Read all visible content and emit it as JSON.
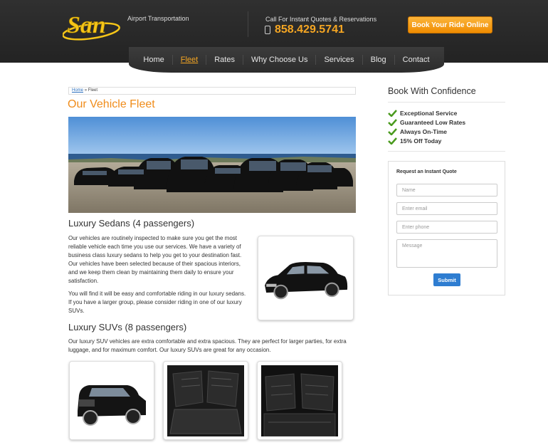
{
  "header": {
    "logo_text": "San",
    "logo_subtitle": "Airport Transportation",
    "call_text": "Call For Instant Quotes & Reservations",
    "phone": "858.429.5741",
    "book_button": "Book Your Ride Online"
  },
  "nav": {
    "items": [
      "Home",
      "Fleet",
      "Rates",
      "Why Choose Us",
      "Services",
      "Blog",
      "Contact"
    ],
    "active": "Fleet"
  },
  "breadcrumb": {
    "home": "Home",
    "separator": "»",
    "current": "Fleet"
  },
  "main": {
    "title": "Our Vehicle Fleet",
    "sedans_heading": "Luxury Sedans (4 passengers)",
    "sedans_p1": "Our vehicles are routinely inspected to make sure you get the most reliable vehicle each time you use our services. We have a variety of business class luxury sedans to help you get to your destination fast. Our vehicles have been selected because of their spacious interiors, and we keep them clean by maintaining them daily to ensure your satisfaction.",
    "sedans_p2": "You will find it will be easy and comfortable riding in our luxury sedans. If you have a larger group, please consider riding in one of our luxury SUVs.",
    "suvs_heading": "Luxury SUVs (8 passengers)",
    "suvs_p1": "Our luxury SUV vehicles are extra comfortable and extra spacious. They are perfect for larger parties, for extra luggage, and for maximum comfort. Our luxury SUVs are great for any occasion."
  },
  "sidebar": {
    "title": "Book With Confidence",
    "features": [
      "Exceptional Service",
      "Guaranteed Low Rates",
      "Always On-Time",
      "15% Off Today"
    ],
    "form": {
      "title": "Request an Instant Quote",
      "name_placeholder": "Name",
      "email_placeholder": "Enter email",
      "phone_placeholder": "Enter phone",
      "message_placeholder": "Message",
      "submit": "Submit"
    }
  },
  "colors": {
    "accent": "#f08c1a",
    "header_bg": "#2a2a2a",
    "submit": "#2e7dd1",
    "check": "#4a9a1e"
  }
}
